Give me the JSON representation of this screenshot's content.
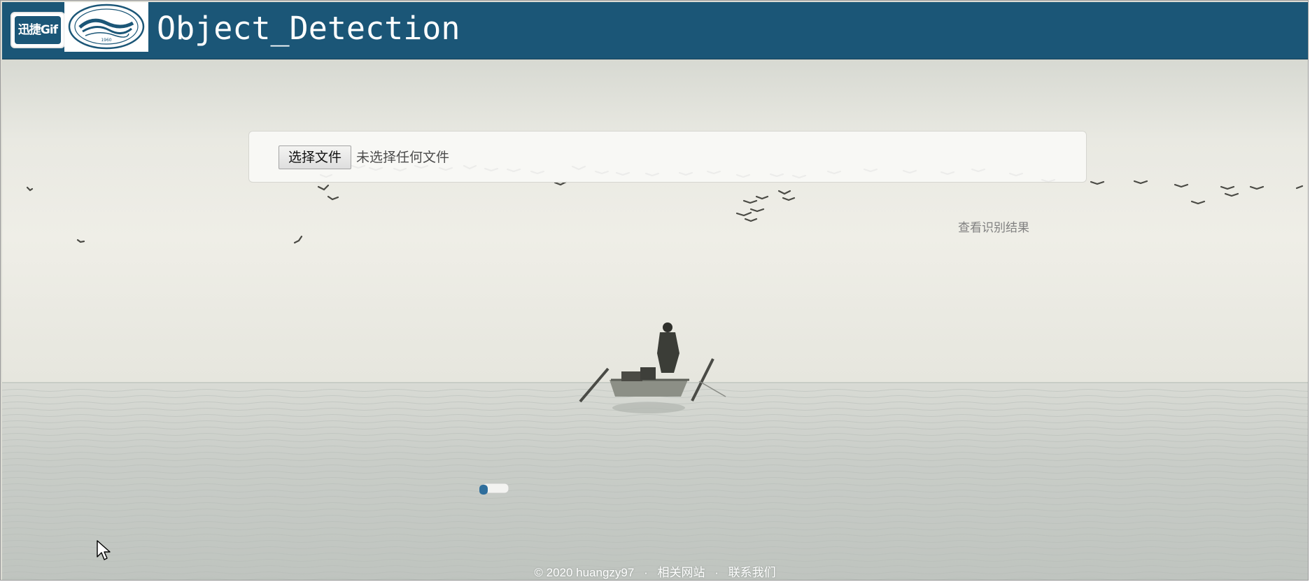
{
  "header": {
    "badge_label": "迅捷Gif",
    "logo_year": "1960",
    "title": "Object_Detection"
  },
  "upload": {
    "button_label": "选择文件",
    "status_text": "未选择任何文件"
  },
  "result_link_label": "查看识别结果",
  "footer": {
    "copyright": "© 2020 huangzy97",
    "separator": "·",
    "related_label": "相关网站",
    "contact_label": "联系我们"
  },
  "icons": {
    "logo": "university-seal-icon",
    "cursor": "mouse-pointer-icon"
  },
  "colors": {
    "navbar": "#1b5677",
    "title_text": "#ffffff",
    "panel_bg": "#f9f9f6",
    "muted_text": "#808080"
  }
}
